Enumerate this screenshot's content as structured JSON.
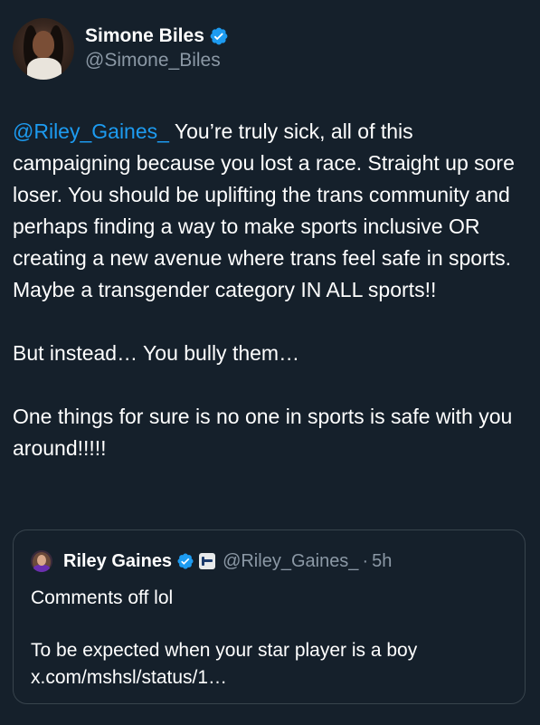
{
  "author": {
    "display_name": "Simone Biles",
    "handle": "@Simone_Biles",
    "avatar_icon": "profile-photo",
    "verified_color": "#1d9bf0"
  },
  "tweet": {
    "mention": "@Riley_Gaines_",
    "paragraph1_rest": " You’re truly sick, all of this campaigning because you lost a race. Straight up sore loser. You should be uplifting the trans community and perhaps finding a way to make sports inclusive OR creating a new avenue where trans feel safe in sports. Maybe a transgender category IN ALL sports!!",
    "paragraph2": "But instead… You bully them…",
    "paragraph3": "One things for sure is no one in sports is safe with you around!!!!!"
  },
  "quoted_tweet": {
    "display_name": "Riley Gaines",
    "handle": "@Riley_Gaines_",
    "separator": "·",
    "time": "5h",
    "text1": "Comments off lol",
    "text2": "To be expected when your star player is a boy",
    "link": "x.com/mshsl/status/1…"
  },
  "colors": {
    "background": "#15202b",
    "link": "#1d9bf0",
    "secondary_text": "#8b98a5",
    "border": "#38444d"
  }
}
